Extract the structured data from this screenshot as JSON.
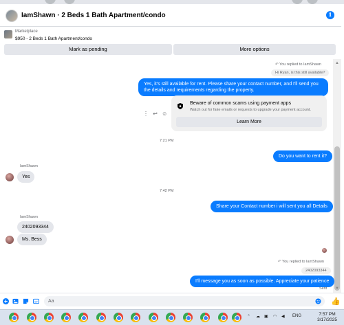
{
  "header": {
    "title": "IamShawn · 2 Beds 1 Bath Apartment/condo"
  },
  "listing": {
    "source": "Marketplace",
    "title": "$950 - 2 Beds 1 Bath Apartment/condo",
    "mark_pending_label": "Mark as pending",
    "more_options_label": "More options"
  },
  "chat": {
    "replied_note_1": "You replied to IamShawn",
    "quoted_1": "Hi Ryan, is this still available?",
    "out_1": "Yes, it's still available for rent. Please share your contact number, and I'll send you the details and requirements regarding the property.",
    "scam_title": "Beware of common scams using payment apps",
    "scam_desc": "Watch out for fake emails or requests to upgrade your payment account.",
    "learn_more_label": "Learn More",
    "time_1": "7:21 PM",
    "out_2": "Do you want to rent it?",
    "sender_1": "IamShawn",
    "in_1": "Yes",
    "time_2": "7:42 PM",
    "out_3": "Share your Contact number i will sent you all Details",
    "sender_2": "IamShawn",
    "in_2": "2402093344",
    "in_3": "Ms. Bess",
    "replied_note_2": "You replied to IamShawn",
    "quoted_2": "2402093344",
    "out_4": "I'll message you as soon as possible. Appreciate your patience",
    "sent_label": "Sent"
  },
  "composer": {
    "placeholder": "Aa"
  },
  "taskbar": {
    "lang": "ENG",
    "time": "7:57 PM",
    "date": "3/17/2025"
  },
  "colors": {
    "accent": "#0a7cff",
    "bubble_in": "#e4e6eb"
  }
}
